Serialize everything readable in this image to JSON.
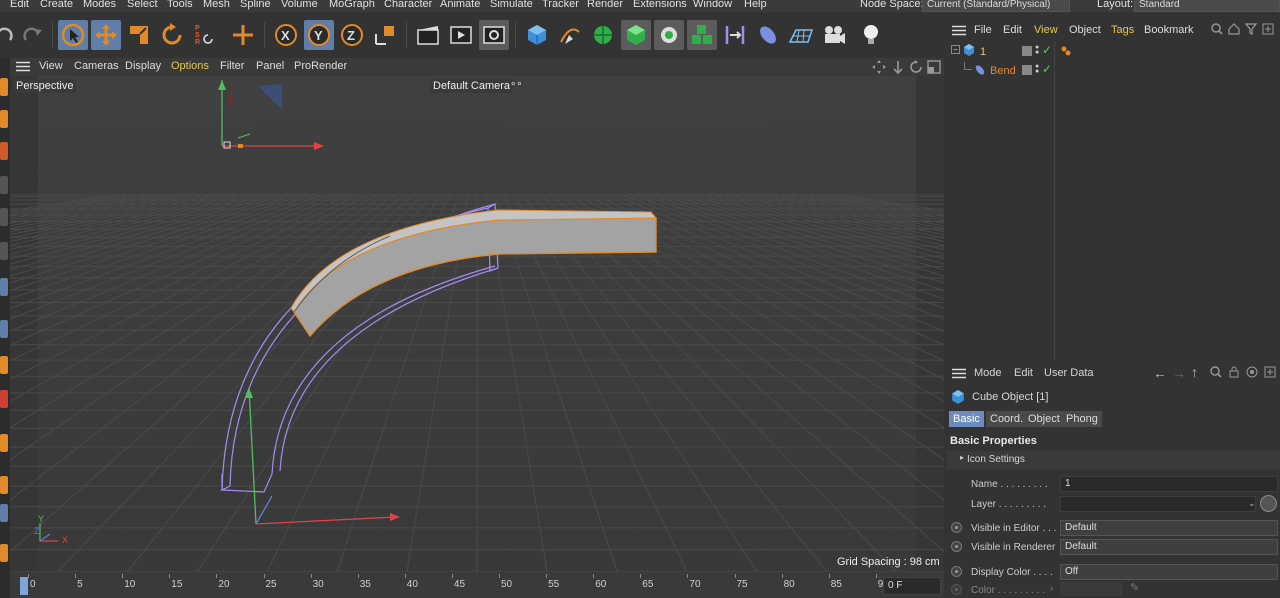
{
  "menubar": {
    "items": [
      "Edit",
      "Create",
      "Modes",
      "Select",
      "Tools",
      "Mesh",
      "Spline",
      "Volume",
      "MoGraph",
      "Character",
      "Animate",
      "Simulate",
      "Tracker",
      "Render",
      "Extensions",
      "Window",
      "Help"
    ],
    "node_space_label": "Node Space:",
    "node_space_value": "Current (Standard/Physical)",
    "layout_label": "Layout:",
    "layout_value": "Standard"
  },
  "toolbar": {
    "coord_x": "X",
    "coord_y": "Y",
    "coord_z": "Z"
  },
  "viewport": {
    "menu": [
      "View",
      "Cameras",
      "Display",
      "Options",
      "Filter",
      "Panel",
      "ProRender"
    ],
    "active_menu": "Options",
    "view_name": "Perspective",
    "camera_label": "Default Camera",
    "grid_spacing": "Grid Spacing : 98 cm",
    "axis_y": "Y",
    "axis_z": "Z",
    "axis_x": "X"
  },
  "timeline": {
    "ticks": [
      "0",
      "5",
      "10",
      "15",
      "20",
      "25",
      "30",
      "35",
      "40",
      "45",
      "50",
      "55",
      "60",
      "65",
      "70",
      "75",
      "80",
      "85",
      "90"
    ],
    "current_frame": "0 F"
  },
  "object_manager": {
    "menu": [
      "File",
      "Edit",
      "View",
      "Object",
      "Tags",
      "Bookmark"
    ],
    "objects": [
      {
        "name": "1"
      },
      {
        "name": "Bend"
      }
    ]
  },
  "attributes": {
    "menu": [
      "Mode",
      "Edit",
      "User Data"
    ],
    "object_title": "Cube Object [1]",
    "tabs": [
      "Basic",
      "Coord.",
      "Object",
      "Phong"
    ],
    "section": "Basic Properties",
    "icon_settings": "Icon Settings",
    "name_label": "Name . . . . . . . . .",
    "name_value": "1",
    "layer_label": "Layer . . . . . . . . .",
    "vis_editor_label": "Visible in Editor . . .",
    "vis_editor_value": "Default",
    "vis_renderer_label": "Visible in Renderer",
    "vis_renderer_value": "Default",
    "display_color_label": "Display Color . . . .",
    "display_color_value": "Off",
    "color_label": "Color . . . . . . . . ."
  },
  "colors": {
    "accent": "#6b8cbd",
    "selection_orange": "#e08a2a",
    "active_green": "#5cc45c",
    "bend_purple": "#a48cf0"
  }
}
